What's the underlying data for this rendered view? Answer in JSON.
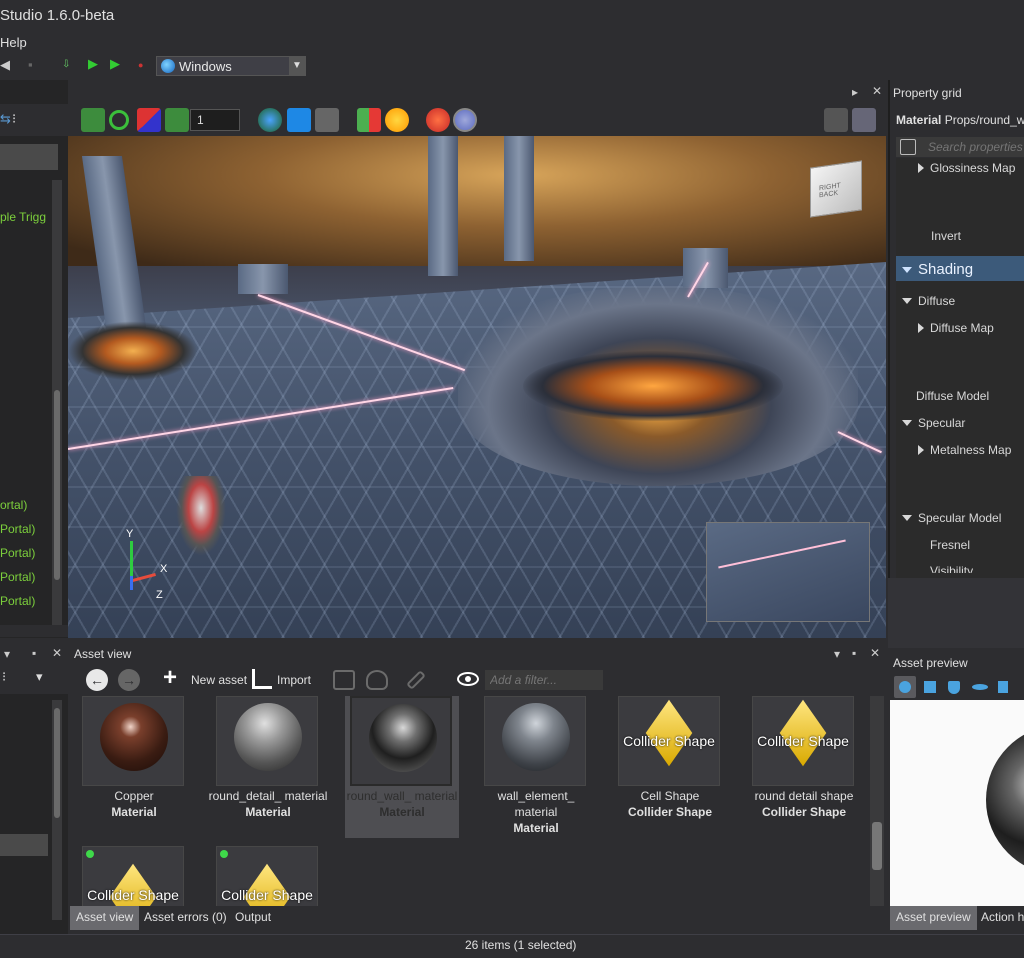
{
  "window": {
    "title": "Studio 1.6.0-beta"
  },
  "menu": {
    "help": "Help"
  },
  "toolbar": {
    "platform": "Windows"
  },
  "viewport_toolbar": {
    "snap_value": "1"
  },
  "viewport": {
    "view_cube_label": "RIGHT BACK",
    "gizmo": {
      "x": "X",
      "y": "Y",
      "z": "Z"
    }
  },
  "scene_tree": {
    "items": [
      "ple Trigg",
      "ortal)",
      " Portal)",
      " Portal)",
      " Portal)",
      " Portal)"
    ]
  },
  "property_grid": {
    "title": "Property grid",
    "material_prefix": "Material",
    "material_path": "Props/round_w",
    "search_placeholder": "Search properties",
    "rows": {
      "glossiness_map": "Glossiness Map",
      "invert": "Invert",
      "shading": "Shading",
      "diffuse": "Diffuse",
      "diffuse_map": "Diffuse Map",
      "diffuse_model": "Diffuse Model",
      "specular": "Specular",
      "metalness_map": "Metalness Map",
      "specular_model": "Specular Model",
      "fresnel": "Fresnel",
      "visibility": "Visibility"
    }
  },
  "asset_view": {
    "title": "Asset view",
    "new_asset": "New asset",
    "import": "Import",
    "filter_placeholder": "Add a filter...",
    "items": [
      {
        "name": "Copper",
        "type": "Material"
      },
      {
        "name": "round_detail_ material",
        "type": "Material"
      },
      {
        "name": "round_wall_ material",
        "type": "Material"
      },
      {
        "name": "wall_element_ material",
        "type": "Material"
      },
      {
        "name": "Cell Shape",
        "type": "Collider Shape",
        "thumb": "Collider Shape"
      },
      {
        "name": "round detail shape",
        "type": "Collider Shape",
        "thumb": "Collider Shape"
      },
      {
        "thumb": "Collider Shape"
      },
      {
        "thumb": "Collider Shape"
      }
    ],
    "tabs": [
      "Asset view",
      "Asset errors (0)",
      "Output"
    ]
  },
  "asset_preview": {
    "title": "Asset preview",
    "tabs": [
      "Asset preview",
      "Action h"
    ]
  },
  "status": {
    "text": "26 items (1 selected)"
  },
  "colors": {
    "accent": "#3c5a7a",
    "selection": "#4e4e52",
    "tree_text": "#7ccf3c"
  }
}
